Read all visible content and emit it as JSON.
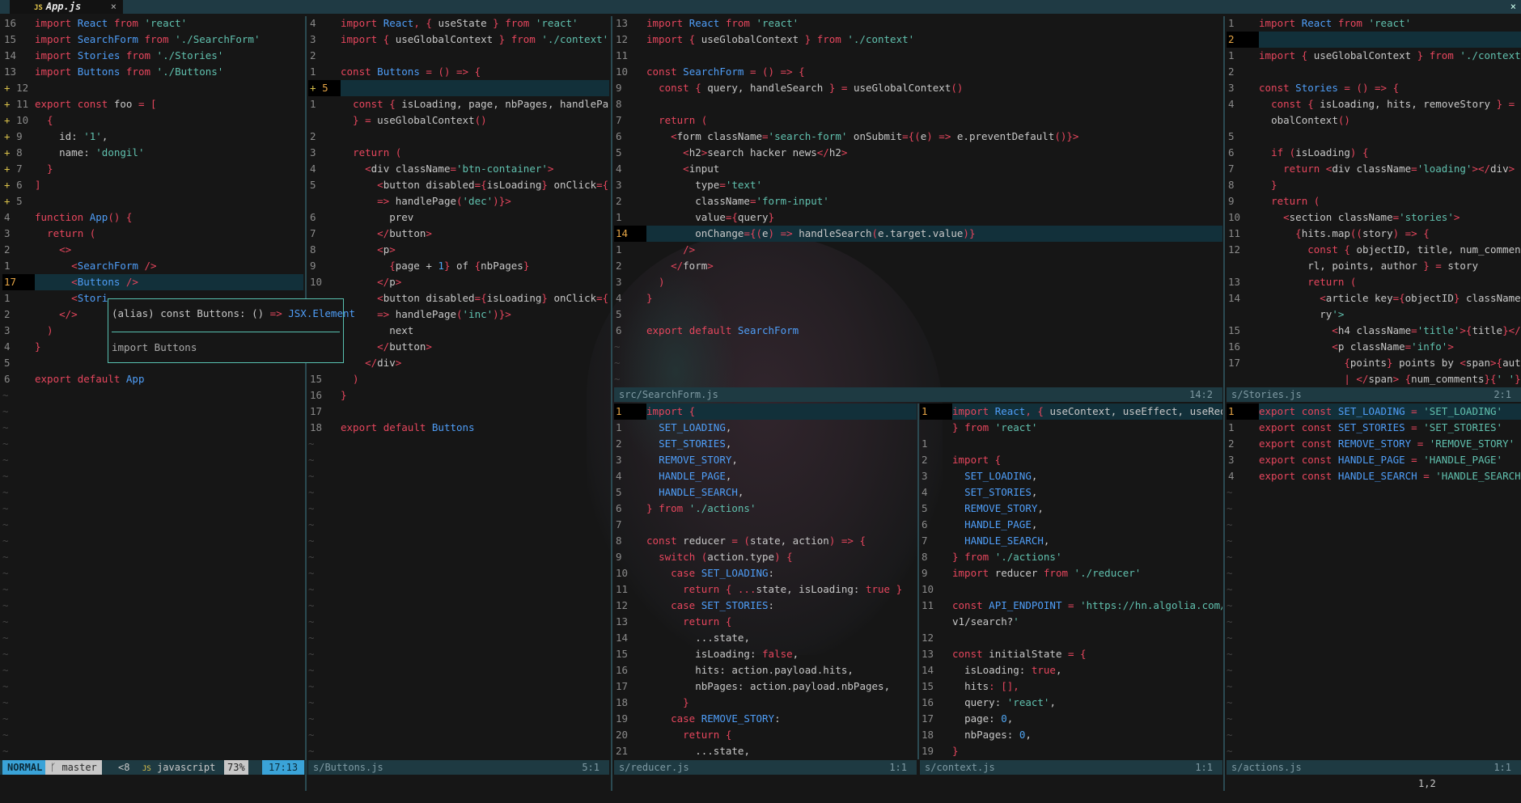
{
  "tab": {
    "icon": "JS",
    "title": "App.js",
    "close": "×"
  },
  "window_close": "×",
  "popup": {
    "sig_prefix": "(alias) const Buttons: () ",
    "sig_arrow": "=> ",
    "sig_type": "JSX.Element",
    "import_text": "import Buttons"
  },
  "status": {
    "mode": "NORMAL",
    "branch": "master",
    "diff": "<8",
    "lang": "javascript",
    "pct": "73%",
    "pos": "17:13",
    "buttons_file": "s/Buttons.js",
    "buttons_pos": "5:1",
    "reducer_file": "s/reducer.js",
    "reducer_pos": "1:1",
    "context_file": "s/context.js",
    "context_pos": "1:1",
    "actions_file": "s/actions.js",
    "actions_pos": "1:1",
    "searchform_file": "src/SearchForm.js",
    "searchform_pos": "14:2",
    "stories_file": "s/Stories.js",
    "stories_pos": "2:1",
    "cmdline": "1,2"
  },
  "panes": {
    "app": [
      [
        "16",
        "",
        "import React from 'react'"
      ],
      [
        "15",
        "",
        "import SearchForm from './SearchForm'"
      ],
      [
        "14",
        "",
        "import Stories from './Stories'"
      ],
      [
        "13",
        "",
        "import Buttons from './Buttons'"
      ],
      [
        "12",
        "+",
        ""
      ],
      [
        "11",
        "+",
        "export const foo = ["
      ],
      [
        "10",
        "+",
        "  {"
      ],
      [
        "9",
        "+",
        "    id: '1',"
      ],
      [
        "8",
        "+",
        "    name: 'dongil'"
      ],
      [
        "7",
        "+",
        "  }"
      ],
      [
        "6",
        "+",
        "]"
      ],
      [
        "5",
        "+",
        ""
      ],
      [
        "4",
        "",
        "function App() {"
      ],
      [
        "3",
        "",
        "  return ("
      ],
      [
        "2",
        "",
        "    <>"
      ],
      [
        "1",
        "",
        "      <SearchForm />"
      ],
      [
        "17",
        "",
        "      <Buttons />"
      ],
      [
        "1",
        "",
        "      <Stori"
      ],
      [
        "2",
        "",
        "    </>"
      ],
      [
        "3",
        "",
        "  )"
      ],
      [
        "4",
        "",
        "}"
      ],
      [
        "5",
        "",
        ""
      ],
      [
        "6",
        "",
        "export default App"
      ]
    ],
    "buttons": [
      [
        "4",
        "",
        "import React, { useState } from 'react'"
      ],
      [
        "3",
        "",
        "import { useGlobalContext } from './context'"
      ],
      [
        "2",
        "",
        ""
      ],
      [
        "1",
        "",
        "const Buttons = () => {"
      ],
      [
        "5",
        "+",
        ""
      ],
      [
        "1",
        "",
        "  const { isLoading, page, nbPages, handlePage"
      ],
      [
        "",
        "",
        "  } = useGlobalContext()"
      ],
      [
        "2",
        "",
        ""
      ],
      [
        "3",
        "",
        "  return ("
      ],
      [
        "4",
        "",
        "    <div className='btn-container'>"
      ],
      [
        "5",
        "",
        "      <button disabled={isLoading} onClick={()"
      ],
      [
        "",
        "",
        "      => handlePage('dec')}>"
      ],
      [
        "6",
        "",
        "        prev"
      ],
      [
        "7",
        "",
        "      </button>"
      ],
      [
        "8",
        "",
        "      <p>"
      ],
      [
        "9",
        "",
        "        {page + 1} of {nbPages}"
      ],
      [
        "10",
        "",
        "      </p>"
      ],
      [
        "",
        "",
        "      <button disabled={isLoading} onClick={()"
      ],
      [
        "",
        "",
        "      => handlePage('inc')}>"
      ],
      [
        "",
        "",
        "        next"
      ],
      [
        "",
        "",
        "      </button>"
      ],
      [
        "",
        "",
        "    </div>"
      ],
      [
        "15",
        "",
        "  )"
      ],
      [
        "16",
        "",
        "}"
      ],
      [
        "17",
        "",
        ""
      ],
      [
        "18",
        "",
        "export default Buttons"
      ]
    ],
    "searchform": [
      [
        "13",
        "",
        "import React from 'react'"
      ],
      [
        "12",
        "",
        "import { useGlobalContext } from './context'"
      ],
      [
        "11",
        "",
        ""
      ],
      [
        "10",
        "",
        "const SearchForm = () => {"
      ],
      [
        "9",
        "",
        "  const { query, handleSearch } = useGlobalContext()"
      ],
      [
        "8",
        "",
        ""
      ],
      [
        "7",
        "",
        "  return ("
      ],
      [
        "6",
        "",
        "    <form className='search-form' onSubmit={(e) => e.preventDefault()}>"
      ],
      [
        "5",
        "",
        "      <h2>search hacker news</h2>"
      ],
      [
        "4",
        "",
        "      <input"
      ],
      [
        "3",
        "",
        "        type='text'"
      ],
      [
        "2",
        "",
        "        className='form-input'"
      ],
      [
        "1",
        "",
        "        value={query}"
      ],
      [
        "14",
        "",
        "        onChange={(e) => handleSearch(e.target.value)}"
      ],
      [
        "1",
        "",
        "      />"
      ],
      [
        "2",
        "",
        "    </form>"
      ],
      [
        "3",
        "",
        "  )"
      ],
      [
        "4",
        "",
        "}"
      ],
      [
        "5",
        "",
        ""
      ],
      [
        "6",
        "",
        "export default SearchForm"
      ]
    ],
    "stories": [
      [
        "1",
        "",
        "import React from 'react'"
      ],
      [
        "2",
        "",
        ""
      ],
      [
        "1",
        "",
        "import { useGlobalContext } from './context'"
      ],
      [
        "2",
        "",
        ""
      ],
      [
        "3",
        "",
        "const Stories = () => {"
      ],
      [
        "4",
        "",
        "  const { isLoading, hits, removeStory } = useGl"
      ],
      [
        "",
        "",
        "  obalContext()"
      ],
      [
        "5",
        "",
        ""
      ],
      [
        "6",
        "",
        "  if (isLoading) {"
      ],
      [
        "7",
        "",
        "    return <div className='loading'></div>"
      ],
      [
        "8",
        "",
        "  }"
      ],
      [
        "9",
        "",
        "  return ("
      ],
      [
        "10",
        "",
        "    <section className='stories'>"
      ],
      [
        "11",
        "",
        "      {hits.map((story) => {"
      ],
      [
        "12",
        "",
        "        const { objectID, title, num_comments, u"
      ],
      [
        "",
        "",
        "        rl, points, author } = story"
      ],
      [
        "13",
        "",
        "        return ("
      ],
      [
        "14",
        "",
        "          <article key={objectID} className='sto"
      ],
      [
        "",
        "",
        "          ry'>"
      ],
      [
        "15",
        "",
        "            <h4 className='title'>{title}</h4>"
      ],
      [
        "16",
        "",
        "            <p className='info'>"
      ],
      [
        "17",
        "",
        "              {points} points by <span>{author}"
      ],
      [
        "",
        "",
        "              | </span> {num_comments}{' '}"
      ]
    ],
    "reducer": [
      [
        "1",
        "",
        "import {"
      ],
      [
        "1",
        "",
        "  SET_LOADING,"
      ],
      [
        "2",
        "",
        "  SET_STORIES,"
      ],
      [
        "3",
        "",
        "  REMOVE_STORY,"
      ],
      [
        "4",
        "",
        "  HANDLE_PAGE,"
      ],
      [
        "5",
        "",
        "  HANDLE_SEARCH,"
      ],
      [
        "6",
        "",
        "} from './actions'"
      ],
      [
        "7",
        "",
        ""
      ],
      [
        "8",
        "",
        "const reducer = (state, action) => {"
      ],
      [
        "9",
        "",
        "  switch (action.type) {"
      ],
      [
        "10",
        "",
        "    case SET_LOADING:"
      ],
      [
        "11",
        "",
        "      return { ...state, isLoading: true }"
      ],
      [
        "12",
        "",
        "    case SET_STORIES:"
      ],
      [
        "13",
        "",
        "      return {"
      ],
      [
        "14",
        "",
        "        ...state,"
      ],
      [
        "15",
        "",
        "        isLoading: false,"
      ],
      [
        "16",
        "",
        "        hits: action.payload.hits,"
      ],
      [
        "17",
        "",
        "        nbPages: action.payload.nbPages,"
      ],
      [
        "18",
        "",
        "      }"
      ],
      [
        "19",
        "",
        "    case REMOVE_STORY:"
      ],
      [
        "20",
        "",
        "      return {"
      ],
      [
        "21",
        "",
        "        ...state,"
      ]
    ],
    "context": [
      [
        "1",
        "",
        "import React, { useContext, useEffect, useReducer"
      ],
      [
        "",
        "",
        "} from 'react'"
      ],
      [
        "1",
        "",
        ""
      ],
      [
        "2",
        "",
        "import {"
      ],
      [
        "3",
        "",
        "  SET_LOADING,"
      ],
      [
        "4",
        "",
        "  SET_STORIES,"
      ],
      [
        "5",
        "",
        "  REMOVE_STORY,"
      ],
      [
        "6",
        "",
        "  HANDLE_PAGE,"
      ],
      [
        "7",
        "",
        "  HANDLE_SEARCH,"
      ],
      [
        "8",
        "",
        "} from './actions'"
      ],
      [
        "9",
        "",
        "import reducer from './reducer'"
      ],
      [
        "10",
        "",
        ""
      ],
      [
        "11",
        "",
        "const API_ENDPOINT = 'https://hn.algolia.com/api/"
      ],
      [
        "",
        "",
        "v1/search?'"
      ],
      [
        "12",
        "",
        ""
      ],
      [
        "13",
        "",
        "const initialState = {"
      ],
      [
        "14",
        "",
        "  isLoading: true,"
      ],
      [
        "15",
        "",
        "  hits: [],"
      ],
      [
        "16",
        "",
        "  query: 'react',"
      ],
      [
        "17",
        "",
        "  page: 0,"
      ],
      [
        "18",
        "",
        "  nbPages: 0,"
      ],
      [
        "19",
        "",
        "}"
      ]
    ],
    "actions": [
      [
        "1",
        "",
        "export const SET_LOADING = 'SET_LOADING'"
      ],
      [
        "1",
        "",
        "export const SET_STORIES = 'SET_STORIES'"
      ],
      [
        "2",
        "",
        "export const REMOVE_STORY = 'REMOVE_STORY'"
      ],
      [
        "3",
        "",
        "export const HANDLE_PAGE = 'HANDLE_PAGE'"
      ],
      [
        "4",
        "",
        "export const HANDLE_SEARCH = 'HANDLE_SEARCH'"
      ]
    ]
  }
}
